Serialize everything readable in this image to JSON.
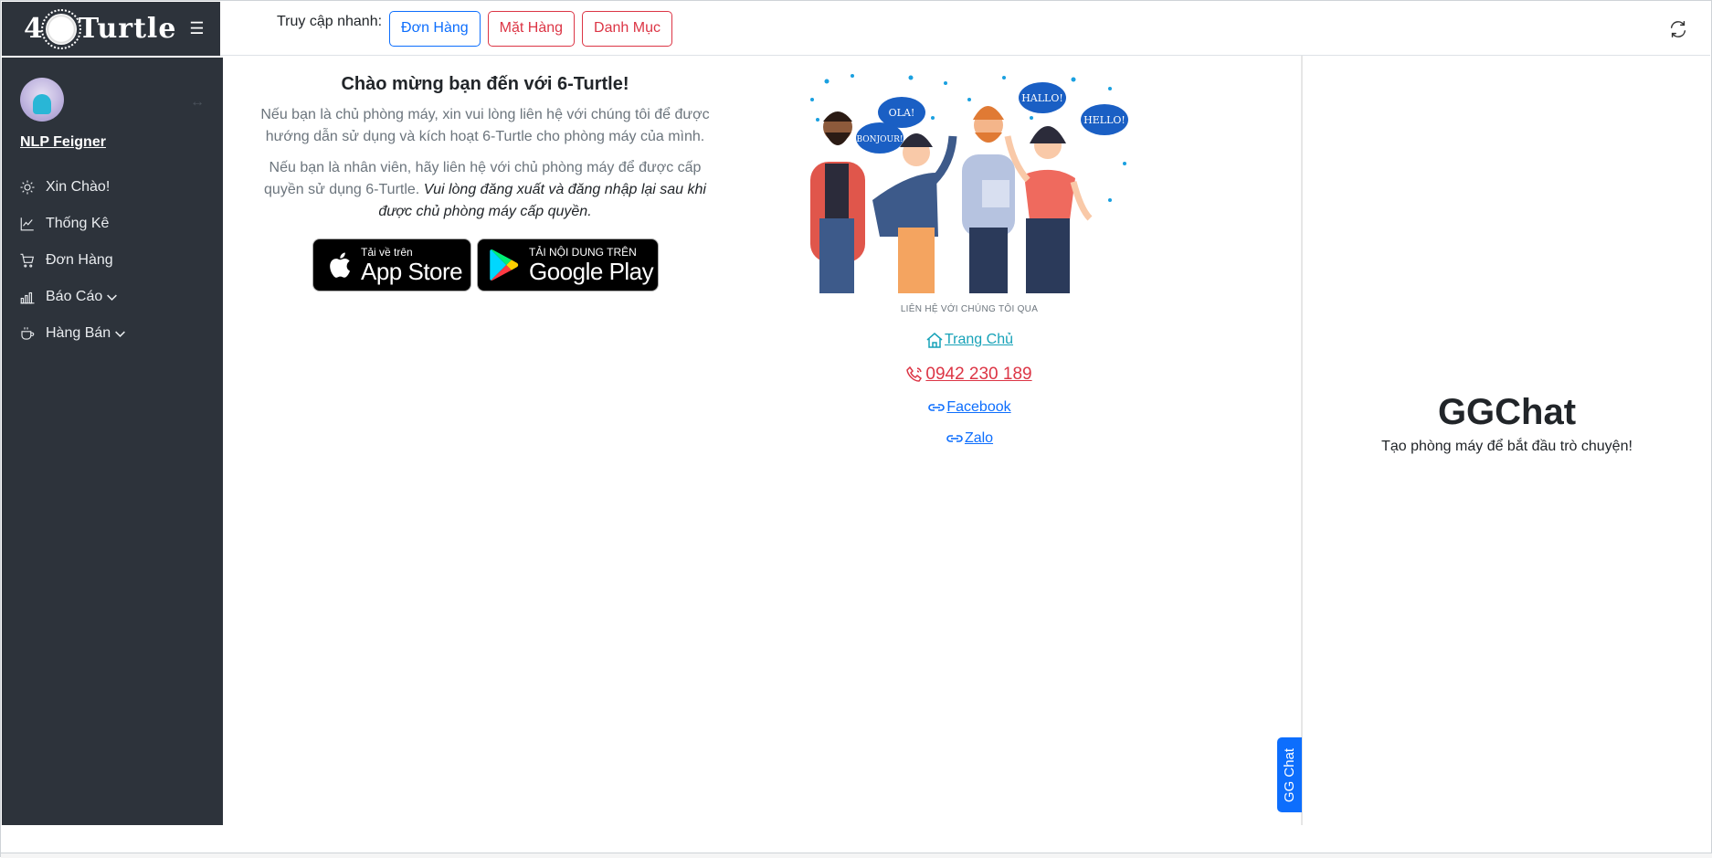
{
  "brand": {
    "logo_text": "Turtle",
    "logo_digit": "4",
    "menu_icon": "hamburger-icon"
  },
  "topbar": {
    "quick_label": "Truy cập nhanh:",
    "quick_buttons": [
      "Đơn Hàng",
      "Mặt Hàng",
      "Danh Mục"
    ],
    "refresh_icon": "refresh-icon"
  },
  "sidebar": {
    "user_name": "NLP Feigner",
    "items": [
      {
        "label": "Xin Chào!",
        "icon": "sun-icon"
      },
      {
        "label": "Thống Kê",
        "icon": "chart-line-icon"
      },
      {
        "label": "Đơn Hàng",
        "icon": "cart-icon"
      },
      {
        "label": "Báo Cáo",
        "icon": "bar-chart-icon"
      },
      {
        "label": "Hàng Bán",
        "icon": "cup-icon"
      }
    ]
  },
  "welcome": {
    "title": "Chào mừng bạn đến với 6-Turtle!",
    "para1": "Nếu bạn là chủ phòng máy, xin vui lòng liên hệ với chúng tôi để được hướng dẫn sử dụng và kích hoạt 6-Turtle cho phòng máy của mình.",
    "para2_plain": "Nếu bạn là nhân viên, hãy liên hệ với chủ phòng máy để được cấp quyền sử dụng 6-Turtle. ",
    "para2_italic": "Vui lòng đăng xuất và đăng nhập lại sau khi được chủ phòng máy cấp quyền."
  },
  "stores": {
    "apple_small": "Tải về trên",
    "apple_big": "App Store",
    "google_small": "TẢI NỘI DUNG TRÊN",
    "google_big": "Google Play"
  },
  "illustration": {
    "bubbles": [
      "OLA!",
      "BONJOUR!",
      "HALLO!",
      "HELLO!"
    ]
  },
  "contact": {
    "title": "LIÊN HỆ VỚI CHÚNG TÔI QUA",
    "home": "Trang Chủ",
    "phone": "0942 230 189",
    "facebook": "Facebook",
    "zalo": "Zalo"
  },
  "chat": {
    "tab_label": "GG Chat",
    "title": "GGChat",
    "subtitle": "Tạo phòng máy để bắt đầu trò chuyện!"
  },
  "colors": {
    "sidebar": "#2d333b",
    "primary": "#0d6efd",
    "danger": "#dc3545",
    "info": "#17a2b8"
  }
}
